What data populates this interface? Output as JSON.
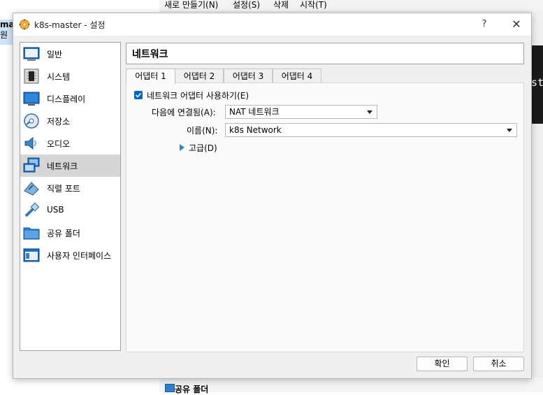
{
  "background": {
    "menu": [
      "새로 만들기(N)",
      "설정(S)",
      "삭제",
      "시작(T)"
    ],
    "left_lines": [
      "ma",
      "원 "
    ],
    "console_text": "st",
    "bottom_text": "공유 폴더"
  },
  "dialog": {
    "title": "k8s-master - 설정",
    "help": "?",
    "close": "✕",
    "sidebar": [
      {
        "label": "일반",
        "icon": "general-icon"
      },
      {
        "label": "시스템",
        "icon": "system-icon"
      },
      {
        "label": "디스플레이",
        "icon": "display-icon"
      },
      {
        "label": "저장소",
        "icon": "storage-icon"
      },
      {
        "label": "오디오",
        "icon": "audio-icon"
      },
      {
        "label": "네트워크",
        "icon": "network-icon",
        "selected": true
      },
      {
        "label": "직렬 포트",
        "icon": "serial-port-icon"
      },
      {
        "label": "USB",
        "icon": "usb-icon"
      },
      {
        "label": "공유 폴더",
        "icon": "shared-folder-icon"
      },
      {
        "label": "사용자 인터페이스",
        "icon": "user-interface-icon"
      }
    ],
    "page_title": "네트워크",
    "tabs": [
      "어댑터 1",
      "어댑터 2",
      "어댑터 3",
      "어댑터 4"
    ],
    "active_tab": 0,
    "adapter": {
      "enable_label": "네트워크 어댑터 사용하기(E)",
      "enabled": true,
      "attached_label": "다음에 연결됨(A):",
      "attached_value": "NAT 네트워크",
      "name_label": "이름(N):",
      "name_value": "k8s Network",
      "advanced_label": "고급(D)"
    },
    "buttons": {
      "ok": "확인",
      "cancel": "취소"
    }
  }
}
